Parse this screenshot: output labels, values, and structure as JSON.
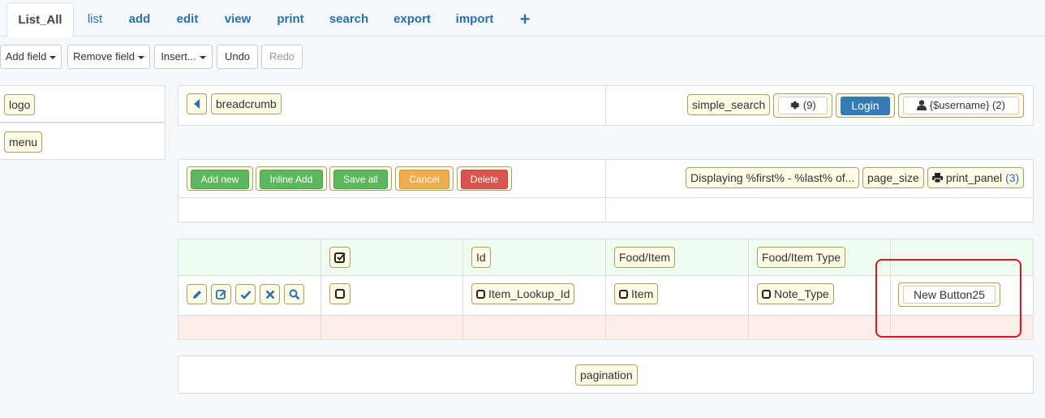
{
  "tabs": [
    {
      "label": "List_All"
    },
    {
      "label": "list"
    },
    {
      "label": "add"
    },
    {
      "label": "edit"
    },
    {
      "label": "view"
    },
    {
      "label": "print"
    },
    {
      "label": "search"
    },
    {
      "label": "export"
    },
    {
      "label": "import"
    },
    {
      "label": "+"
    }
  ],
  "toolbar": {
    "add_field": "Add field",
    "remove_field": "Remove field",
    "insert": "Insert...",
    "undo": "Undo",
    "redo": "Redo"
  },
  "left": {
    "logo": "logo",
    "menu": "menu"
  },
  "header": {
    "breadcrumb": "breadcrumb",
    "simple_search": "simple_search",
    "settings_count": "(9)",
    "login": "Login",
    "username": "{$username} (2)"
  },
  "actions": {
    "add_new": "Add new",
    "inline_add": "Inline Add",
    "save_all": "Save all",
    "cancel": "Cancel",
    "delete": "Delete",
    "displaying": "Displaying %first% - %last% of...",
    "page_size": "page_size",
    "print_panel": "print_panel",
    "print_count": "(3)"
  },
  "grid": {
    "headers": [
      "Id",
      "Food/Item",
      "Food/Item Type"
    ],
    "cells": [
      "Item_Lookup_Id",
      "Item",
      "Note_Type"
    ],
    "new_button": "New Button25"
  },
  "footer": {
    "pagination": "pagination"
  },
  "colors": {
    "success": "#5cb85c",
    "warning": "#f0ad4e",
    "danger": "#d9534f",
    "primary": "#337ab7",
    "highlight": "#e0141e"
  },
  "icons": [
    "caret-left-icon",
    "gear-icon",
    "user-icon",
    "print-icon",
    "pencil-icon",
    "edit-icon",
    "check-icon",
    "times-icon",
    "search-icon",
    "checkbox-icon"
  ]
}
